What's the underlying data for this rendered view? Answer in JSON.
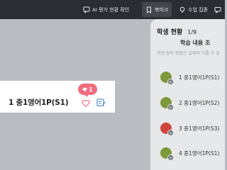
{
  "toolbar": {
    "ai_check_label": "AI 평가 현황 확인",
    "bookmark_label": "북마크",
    "focus_label": "수업 집중"
  },
  "card": {
    "student_name": "1 중1영어1P(S1)",
    "like_count": "1"
  },
  "panel": {
    "title": "학생 현황",
    "count": "1/9",
    "subtitle": "학습 내용 조",
    "note": "학생 접속 현황은 실제와 다를 수 있",
    "students": [
      {
        "name": "1 중1영어1P(S1)",
        "status": "green",
        "badge": "✕"
      },
      {
        "name": "2 중1영어1P(S2)",
        "status": "green",
        "badge": "✕"
      },
      {
        "name": "3 중1영어1P(S3)",
        "status": "red",
        "badge": "✕"
      },
      {
        "name": "4 중1영어1P(S1)",
        "status": "green",
        "badge": "✕"
      }
    ]
  },
  "colors": {
    "toolbar_bg": "#2a2e33",
    "like_pink": "#f16c7f",
    "status_green": "#7c9a3c",
    "status_red": "#d0463c"
  }
}
